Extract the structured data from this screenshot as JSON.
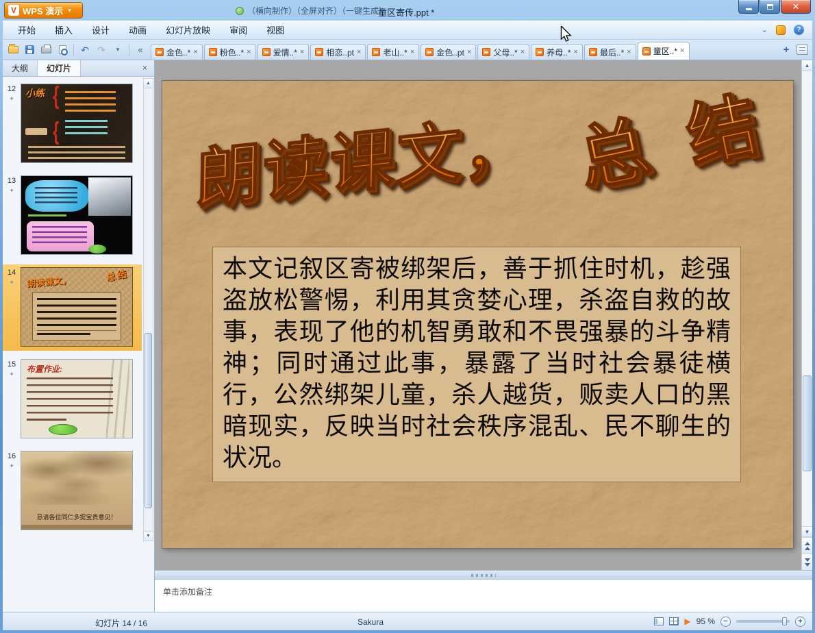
{
  "colors": {
    "wordart_orange": "#f07800",
    "slide_tan": "#c7a26e",
    "textbox_tan": "#d8bc90",
    "selection_yellow": "#f5ba4a",
    "titlebar_blue": "#6aa0d8",
    "close_red": "#dd5f3e"
  },
  "titlebar": {
    "app_button": "WPS 演示",
    "note": "（横向制作）（全屏对齐）（一键生成）",
    "title": "童区寄传.ppt *",
    "close_glyph": "✕"
  },
  "menubar": {
    "items": [
      "开始",
      "插入",
      "设计",
      "动画",
      "幻灯片放映",
      "审阅",
      "视图"
    ],
    "help_glyph": "?"
  },
  "doc_tabs": {
    "scroll_left_glyph": "«",
    "close_glyph": "×",
    "new_tab_glyph": "+",
    "tabs": [
      {
        "label": "金色..*"
      },
      {
        "label": "粉色..*"
      },
      {
        "label": "爱情..*"
      },
      {
        "label": "相恋..pt"
      },
      {
        "label": "老山..*"
      },
      {
        "label": "金色..pt"
      },
      {
        "label": "父母..*"
      },
      {
        "label": "养母..*"
      },
      {
        "label": "最后..*"
      },
      {
        "label": "童区..*"
      }
    ]
  },
  "left_panel": {
    "tab_outline": "大纲",
    "tab_slides": "幻灯片",
    "close_glyph": "×",
    "star_glyph": "✦",
    "slides": [
      {
        "num": "12",
        "caption": "小练"
      },
      {
        "num": "13",
        "caption": ""
      },
      {
        "num": "14",
        "title1": "朗读课文，",
        "title2": "总结"
      },
      {
        "num": "15",
        "caption": "布置作业:"
      },
      {
        "num": "16",
        "caption": "恳请各位同仁多提宝贵意见！"
      }
    ]
  },
  "slide": {
    "title_part1": "朗读课文，",
    "title_part2": "总 结",
    "body": "本文记叙区寄被绑架后，善于抓住时机，趁强盗放松警惕，利用其贪婪心理，杀盗自救的故事，表现了他的机智勇敢和不畏强暴的斗争精神；同时通过此事，暴露了当时社会暴徒横行，公然绑架儿童，杀人越货，贩卖人口的黑暗现实，反映当时社会秩序混乱、民不聊生的状况。"
  },
  "notes": {
    "placeholder": "单击添加备注"
  },
  "statusbar": {
    "slide_counter": "幻灯片 14 / 16",
    "theme": "Sakura",
    "zoom": "95 %"
  }
}
